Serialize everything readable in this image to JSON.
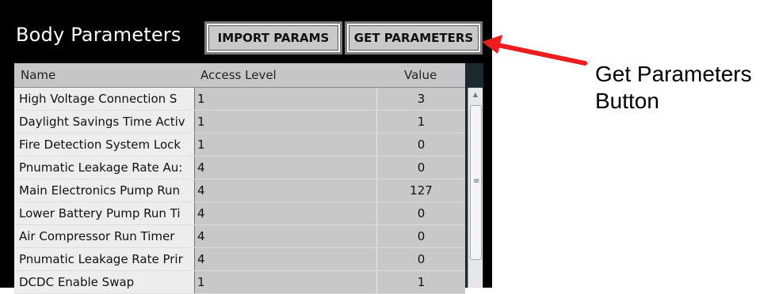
{
  "panel": {
    "title": "Body Parameters",
    "buttons": {
      "import": "IMPORT PARAMS",
      "get": "GET PARAMETERS"
    }
  },
  "table": {
    "headers": {
      "name": "Name",
      "access": "Access Level",
      "value": "Value"
    },
    "rows": [
      {
        "name": "High Voltage Connection S",
        "access": "1",
        "value": "3"
      },
      {
        "name": "Daylight Savings Time Activ",
        "access": "1",
        "value": "1"
      },
      {
        "name": "Fire Detection System Lock",
        "access": "1",
        "value": "0"
      },
      {
        "name": "Pnumatic Leakage Rate Au:",
        "access": "4",
        "value": "0"
      },
      {
        "name": "Main Electronics Pump Run",
        "access": "4",
        "value": "127"
      },
      {
        "name": "Lower Battery Pump Run Ti",
        "access": "4",
        "value": "0"
      },
      {
        "name": "Air Compressor Run Timer",
        "access": "4",
        "value": "0"
      },
      {
        "name": "Pnumatic Leakage Rate Prir",
        "access": "4",
        "value": "0"
      },
      {
        "name": "DCDC Enable Swap",
        "access": "1",
        "value": "1"
      }
    ]
  },
  "annotation": {
    "line1": "Get Parameters",
    "line2": "Button",
    "color": "#ee1c1c"
  },
  "icons": {
    "scroll_up": "scroll-up-arrow-icon",
    "grip": "scroll-grip-icon",
    "annotation_arrow": "red-arrow-icon"
  }
}
